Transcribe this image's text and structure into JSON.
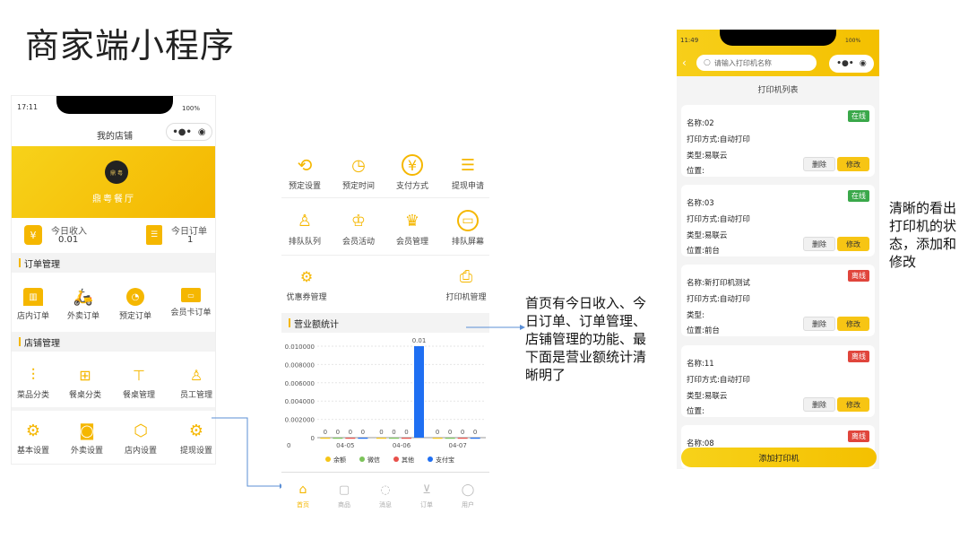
{
  "slide_title": "商家端小程序",
  "note_middle": "首页有今日收入、今日订单、订单管理、店铺管理的功能、最下面是营业额统计清晰明了",
  "note_right": "清晰的看出打印机的状态，添加和修改",
  "phone1": {
    "time": "17:11",
    "battery": "100%",
    "nav_title": "我的店铺",
    "logo_text": "鼎 粤",
    "shop_name": "鼎粤餐厅",
    "stats": [
      {
        "label": "今日收入",
        "value": "0.01"
      },
      {
        "label": "今日订单",
        "value": "1"
      }
    ],
    "section_order": "订单管理",
    "order_items": [
      "店内订单",
      "外卖订单",
      "预定订单",
      "会员卡订单"
    ],
    "section_shop": "店铺管理",
    "shop_items_row1": [
      "菜品分类",
      "餐桌分类",
      "餐桌管理",
      "员工管理"
    ],
    "shop_items_row2": [
      "基本设置",
      "外卖设置",
      "店内设置",
      "提现设置"
    ]
  },
  "phone2": {
    "grid_row1": [
      "预定设置",
      "预定时间",
      "支付方式",
      "提现申请"
    ],
    "grid_row2": [
      "排队队列",
      "会员活动",
      "会员管理",
      "排队屏幕"
    ],
    "grid_row3": [
      "优惠券管理",
      "打印机管理"
    ],
    "section_chart": "营业额统计",
    "tabbar": [
      "首页",
      "商品",
      "消息",
      "订单",
      "用户"
    ]
  },
  "chart_data": {
    "type": "bar",
    "categories": [
      "04-05",
      "04-06",
      "04-07"
    ],
    "series": [
      {
        "name": "余额",
        "values": [
          0,
          0,
          0
        ],
        "color": "#f5c518"
      },
      {
        "name": "微信",
        "values": [
          0,
          0,
          0
        ],
        "color": "#7cc35a"
      },
      {
        "name": "其他",
        "values": [
          0,
          0,
          0
        ],
        "color": "#e8504a"
      },
      {
        "name": "支付宝",
        "values": [
          0,
          0.01,
          0
        ],
        "color": "#1f6ff2"
      }
    ],
    "yticks": [
      "0.010000",
      "0.008000",
      "0.006000",
      "0.004000",
      "0.002000",
      "0"
    ],
    "ylim": [
      0,
      0.01
    ],
    "top_label": "0.01",
    "legend_position": "bottom"
  },
  "phone3": {
    "time": "11:49",
    "battery": "100%",
    "search_placeholder": "请输入打印机名称",
    "list_title": "打印机列表",
    "printers": [
      {
        "name": "名称:02",
        "mode": "打印方式:自动打印",
        "type": "类型:易联云",
        "loc": "位置:",
        "status": "在线",
        "status_color": "#3aa84a"
      },
      {
        "name": "名称:03",
        "mode": "打印方式:自动打印",
        "type": "类型:易联云",
        "loc": "位置:前台",
        "status": "在线",
        "status_color": "#3aa84a"
      },
      {
        "name": "名称:新打印机测试",
        "mode": "打印方式:自动打印",
        "type": "类型:",
        "loc": "位置:前台",
        "status": "离线",
        "status_color": "#e0453c"
      },
      {
        "name": "名称:11",
        "mode": "打印方式:自动打印",
        "type": "类型:易联云",
        "loc": "位置:",
        "status": "离线",
        "status_color": "#e0453c"
      },
      {
        "name": "名称:08",
        "status": "离线",
        "status_color": "#e0453c"
      }
    ],
    "btn_delete": "删除",
    "btn_edit": "修改",
    "add_button": "添加打印机"
  }
}
